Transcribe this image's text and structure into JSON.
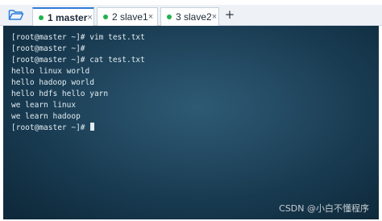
{
  "tabs": [
    {
      "label": "1 master",
      "active": true,
      "status_color": "#22b14c",
      "close_label": "×"
    },
    {
      "label": "2 slave1",
      "active": false,
      "status_color": "#22b14c",
      "close_label": "×"
    },
    {
      "label": "3 slave2",
      "active": false,
      "status_color": "#22b14c",
      "close_label": "×"
    }
  ],
  "toolbar": {
    "folder_icon": "folder-icon",
    "add_tab_label": "+"
  },
  "terminal": {
    "lines": [
      "[root@master ~]# vim test.txt",
      "[root@master ~]#",
      "[root@master ~]# cat test.txt",
      "hello linux world",
      "hello hadoop world",
      "hello hdfs hello yarn",
      "we learn linux",
      "we learn hadoop",
      "[root@master ~]#"
    ]
  },
  "watermark": "CSDN @小白不懂程序",
  "colors": {
    "accent": "#2f7cd9",
    "status_dot": "#22b14c",
    "terminal_text": "#e3ecf2"
  }
}
